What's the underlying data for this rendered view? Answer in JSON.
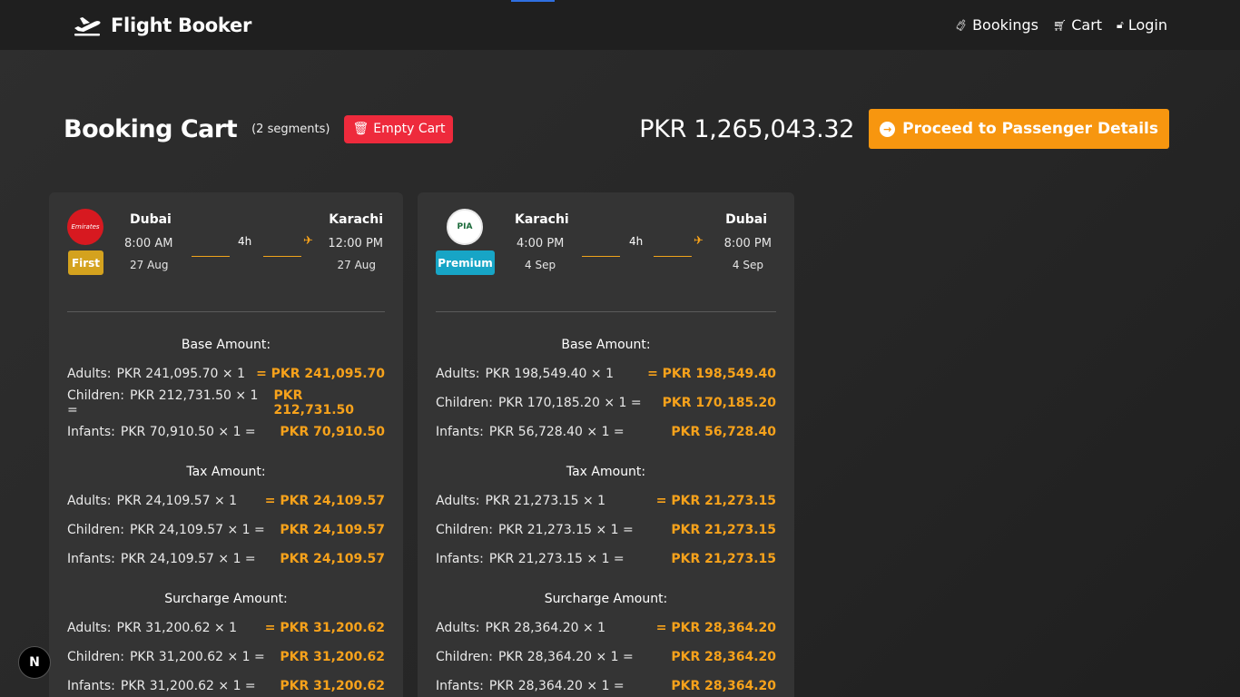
{
  "nav": {
    "brand": "Flight Booker",
    "links": [
      {
        "icon": "suitcase-icon",
        "label": "Bookings"
      },
      {
        "icon": "cart-icon",
        "label": "Cart"
      },
      {
        "icon": "unlock-icon",
        "label": "Login"
      }
    ]
  },
  "header": {
    "title": "Booking Cart",
    "segments": "(2 segments)",
    "empty_label": "Empty Cart",
    "total": "PKR 1,265,043.32",
    "proceed_label": "Proceed to Passenger Details"
  },
  "cards": [
    {
      "airline_logo_text": "Emirates",
      "cabin": "First",
      "from": {
        "city": "Dubai",
        "time": "8:00 AM",
        "date": "27 Aug"
      },
      "to": {
        "city": "Karachi",
        "time": "12:00 PM",
        "date": "27 Aug"
      },
      "duration": "4h",
      "base_title": "Base Amount:",
      "base": [
        {
          "label": "Adults:",
          "calc": "PKR 241,095.70 × 1",
          "total": "= PKR 241,095.70"
        },
        {
          "label": "Children:",
          "calc": "PKR 212,731.50 × 1 =",
          "total": "PKR 212,731.50"
        },
        {
          "label": "Infants:",
          "calc": "PKR 70,910.50 × 1 =",
          "total": "PKR 70,910.50"
        }
      ],
      "tax_title": "Tax Amount:",
      "tax": [
        {
          "label": "Adults:",
          "calc": "PKR 24,109.57 × 1",
          "total": "= PKR 24,109.57"
        },
        {
          "label": "Children:",
          "calc": "PKR 24,109.57 × 1 =",
          "total": "PKR 24,109.57"
        },
        {
          "label": "Infants:",
          "calc": "PKR 24,109.57 × 1 =",
          "total": "PKR 24,109.57"
        }
      ],
      "surcharge_title": "Surcharge Amount:",
      "surcharge": [
        {
          "label": "Adults:",
          "calc": "PKR 31,200.62 × 1",
          "total": "= PKR 31,200.62"
        },
        {
          "label": "Children:",
          "calc": "PKR 31,200.62 × 1 =",
          "total": "PKR 31,200.62"
        },
        {
          "label": "Infants:",
          "calc": "PKR 31,200.62 × 1 =",
          "total": "PKR 31,200.62"
        }
      ]
    },
    {
      "airline_logo_text": "PIA",
      "cabin": "Premium",
      "from": {
        "city": "Karachi",
        "time": "4:00 PM",
        "date": "4 Sep"
      },
      "to": {
        "city": "Dubai",
        "time": "8:00 PM",
        "date": "4 Sep"
      },
      "duration": "4h",
      "base_title": "Base Amount:",
      "base": [
        {
          "label": "Adults:",
          "calc": "PKR 198,549.40 × 1",
          "total": "= PKR 198,549.40"
        },
        {
          "label": "Children:",
          "calc": "PKR 170,185.20 × 1 =",
          "total": "PKR 170,185.20"
        },
        {
          "label": "Infants:",
          "calc": "PKR 56,728.40 × 1 =",
          "total": "PKR 56,728.40"
        }
      ],
      "tax_title": "Tax Amount:",
      "tax": [
        {
          "label": "Adults:",
          "calc": "PKR 21,273.15 × 1",
          "total": "= PKR 21,273.15"
        },
        {
          "label": "Children:",
          "calc": "PKR 21,273.15 × 1 =",
          "total": "PKR 21,273.15"
        },
        {
          "label": "Infants:",
          "calc": "PKR 21,273.15 × 1 =",
          "total": "PKR 21,273.15"
        }
      ],
      "surcharge_title": "Surcharge Amount:",
      "surcharge": [
        {
          "label": "Adults:",
          "calc": "PKR 28,364.20 × 1",
          "total": "= PKR 28,364.20"
        },
        {
          "label": "Children:",
          "calc": "PKR 28,364.20 × 1 =",
          "total": "PKR 28,364.20"
        },
        {
          "label": "Infants:",
          "calc": "PKR 28,364.20 × 1 =",
          "total": "PKR 28,364.20"
        }
      ]
    }
  ],
  "dev_badge": "N"
}
